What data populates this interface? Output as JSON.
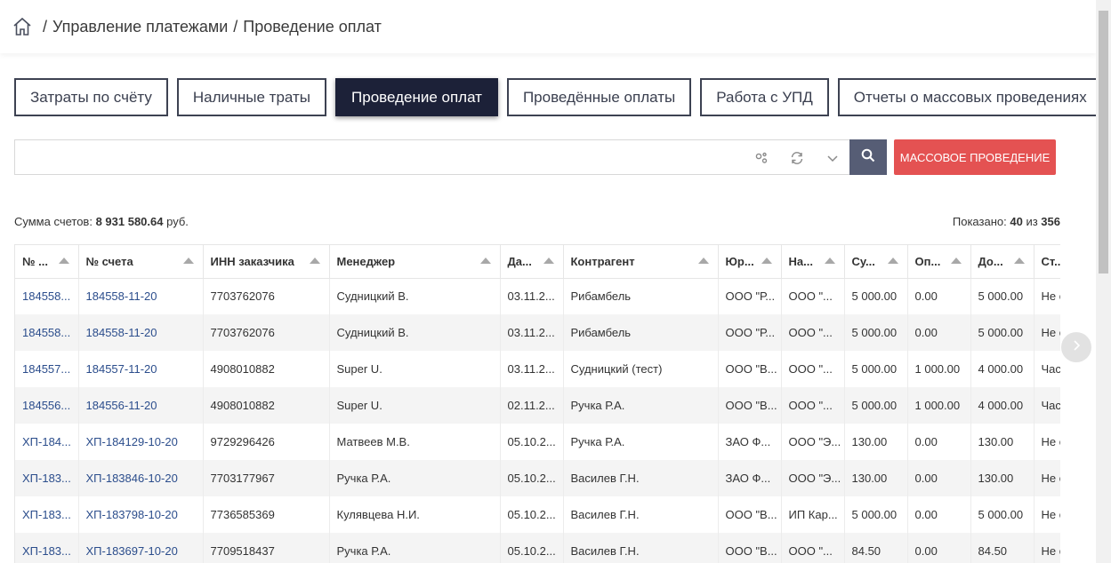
{
  "breadcrumb": {
    "items": [
      "Управление платежами",
      "Проведение оплат"
    ],
    "separator": "/"
  },
  "tabs": [
    {
      "label": "Затраты по счёту",
      "active": false
    },
    {
      "label": "Наличные траты",
      "active": false
    },
    {
      "label": "Проведение оплат",
      "active": true
    },
    {
      "label": "Проведённые оплаты",
      "active": false
    },
    {
      "label": "Работа с УПД",
      "active": false
    },
    {
      "label": "Отчеты о массовых проведениях",
      "active": false
    }
  ],
  "search": {
    "value": "",
    "placeholder": ""
  },
  "mass_button": "МАССОВОЕ ПРОВЕДЕНИЕ",
  "summary": {
    "label": "Сумма счетов:",
    "value": "8 931 580.64",
    "unit": "руб."
  },
  "shown": {
    "label": "Показано:",
    "count": "40",
    "of": "из",
    "total": "356"
  },
  "table": {
    "columns": [
      "№ ...",
      "№ счета",
      "ИНН заказчика",
      "Менеджер",
      "Да...",
      "Контрагент",
      "Юр...",
      "На...",
      "Су...",
      "Оп...",
      "До...",
      "Ст..."
    ],
    "rows": [
      [
        "184558...",
        "184558-11-20",
        "7703762076",
        "Судницкий В.",
        "03.11.2...",
        "Рибамбель",
        "ООО \"Р...",
        "ООО \"...",
        "5 000.00",
        "0.00",
        "5 000.00",
        "Не о"
      ],
      [
        "184558...",
        "184558-11-20",
        "7703762076",
        "Судницкий В.",
        "03.11.2...",
        "Рибамбель",
        "ООО \"Р...",
        "ООО \"...",
        "5 000.00",
        "0.00",
        "5 000.00",
        "Не о"
      ],
      [
        "184557...",
        "184557-11-20",
        "4908010882",
        "Super U.",
        "03.11.2...",
        "Судницкий (тест)",
        "ООО \"В...",
        "ООО \"...",
        "5 000.00",
        "1 000.00",
        "4 000.00",
        "Час"
      ],
      [
        "184556...",
        "184556-11-20",
        "4908010882",
        "Super U.",
        "02.11.2...",
        "Ручка Р.А.",
        "ООО \"В...",
        "ООО \"...",
        "5 000.00",
        "1 000.00",
        "4 000.00",
        "Час"
      ],
      [
        "ХП-184...",
        "ХП-184129-10-20",
        "9729296426",
        "Матвеев М.В.",
        "05.10.2...",
        "Ручка Р.А.",
        "ЗАО Ф...",
        "ООО \"Э...",
        "130.00",
        "0.00",
        "130.00",
        "Не о"
      ],
      [
        "ХП-183...",
        "ХП-183846-10-20",
        "7703177967",
        "Ручка Р.А.",
        "05.10.2...",
        "Василев Г.Н.",
        "ЗАО Ф...",
        "ООО \"Э...",
        "130.00",
        "0.00",
        "130.00",
        "Не о"
      ],
      [
        "ХП-183...",
        "ХП-183798-10-20",
        "7736585369",
        "Кулявцева Н.И.",
        "05.10.2...",
        "Василев Г.Н.",
        "ООО \"В...",
        "ИП Кар...",
        "5 000.00",
        "0.00",
        "5 000.00",
        "Не о"
      ],
      [
        "ХП-183...",
        "ХП-183697-10-20",
        "7709518437",
        "Ручка Р.А.",
        "05.10.2...",
        "Василев Г.Н.",
        "ООО \"В...",
        "ООО \"...",
        "84.50",
        "0.00",
        "84.50",
        "Не о"
      ]
    ]
  },
  "colors": {
    "accent_dark": "#1c2138",
    "search_button": "#565d75",
    "mass_button": "#e45252",
    "link": "#2b4d8c"
  }
}
